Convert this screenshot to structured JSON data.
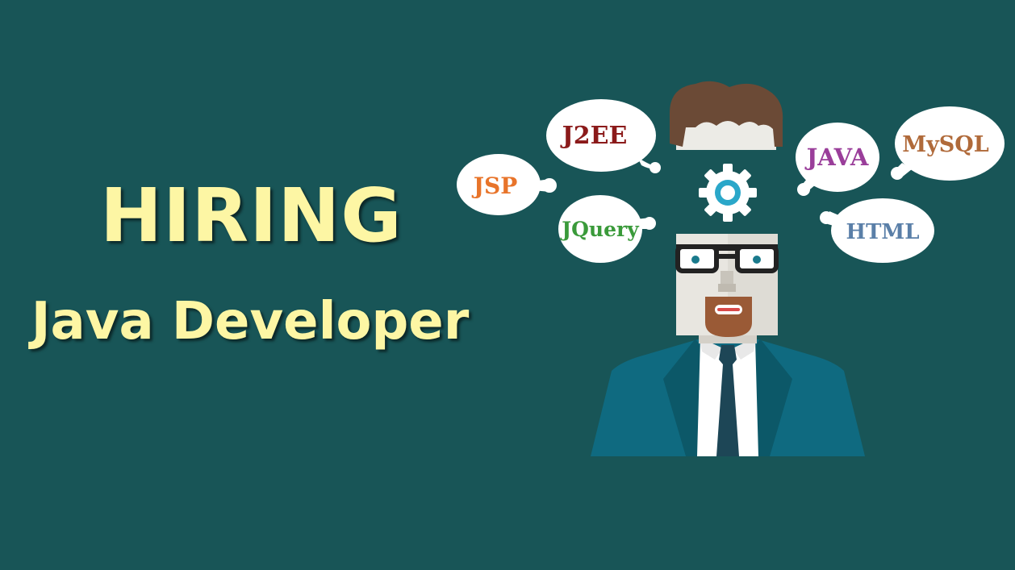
{
  "headline": {
    "title": "HIRING",
    "subtitle": "Java Developer"
  },
  "colors": {
    "background": "#185557",
    "headline_text": "#fdf6a4"
  },
  "skills": [
    {
      "label": "J2EE",
      "color": "#8b1a1a"
    },
    {
      "label": "JSP",
      "color": "#e8742a"
    },
    {
      "label": "JQuery",
      "color": "#3a9a3a"
    },
    {
      "label": "JAVA",
      "color": "#9a3e9a"
    },
    {
      "label": "MySQL",
      "color": "#b06a3a"
    },
    {
      "label": "HTML",
      "color": "#5a7fa8"
    }
  ],
  "icons": [
    "gear-icon",
    "developer-avatar"
  ]
}
